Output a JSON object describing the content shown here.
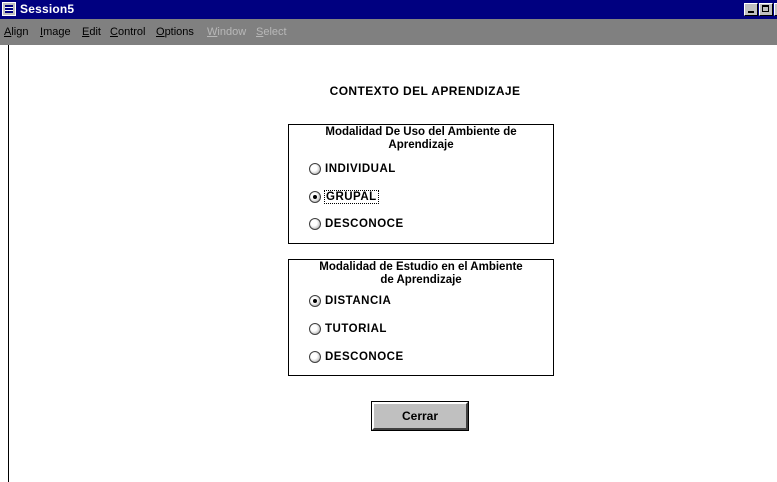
{
  "window": {
    "title": "Session5",
    "controls": [
      "minimize-icon",
      "maximize-icon",
      "close-icon"
    ]
  },
  "menu": [
    {
      "label": "Align",
      "underline": "A",
      "rest": "lign",
      "enabled": true
    },
    {
      "label": "Image",
      "underline": "I",
      "rest": "mage",
      "enabled": true
    },
    {
      "label": "Edit",
      "underline": "E",
      "rest": "dit",
      "enabled": true
    },
    {
      "label": "Control",
      "underline": "C",
      "rest": "ontrol",
      "enabled": true
    },
    {
      "label": "Options",
      "underline": "O",
      "rest": "ptions",
      "enabled": true
    },
    {
      "label": "Window",
      "underline": "W",
      "rest": "indow",
      "enabled": false
    },
    {
      "label": "Select",
      "underline": "S",
      "rest": "elect",
      "enabled": false
    }
  ],
  "form": {
    "heading": "CONTEXTO DEL APRENDIZAJE",
    "group1": {
      "title_line1": "Modalidad De Uso del Ambiente de",
      "title_line2": "Aprendizaje",
      "options": [
        "INDIVIDUAL",
        "GRUPAL",
        "DESCONOCE"
      ],
      "selected": "GRUPAL"
    },
    "group2": {
      "title_line1": "Modalidad de Estudio en el Ambiente",
      "title_line2": "de Aprendizaje",
      "options": [
        "DISTANCIA",
        "TUTORIAL",
        "DESCONOCE"
      ],
      "selected": "DISTANCIA"
    },
    "close_button": "Cerrar"
  },
  "colors": {
    "titlebar": "#000080",
    "menubar": "#808080",
    "button_face": "#c0c0c0",
    "disabled_text": "#b8b8b8"
  }
}
